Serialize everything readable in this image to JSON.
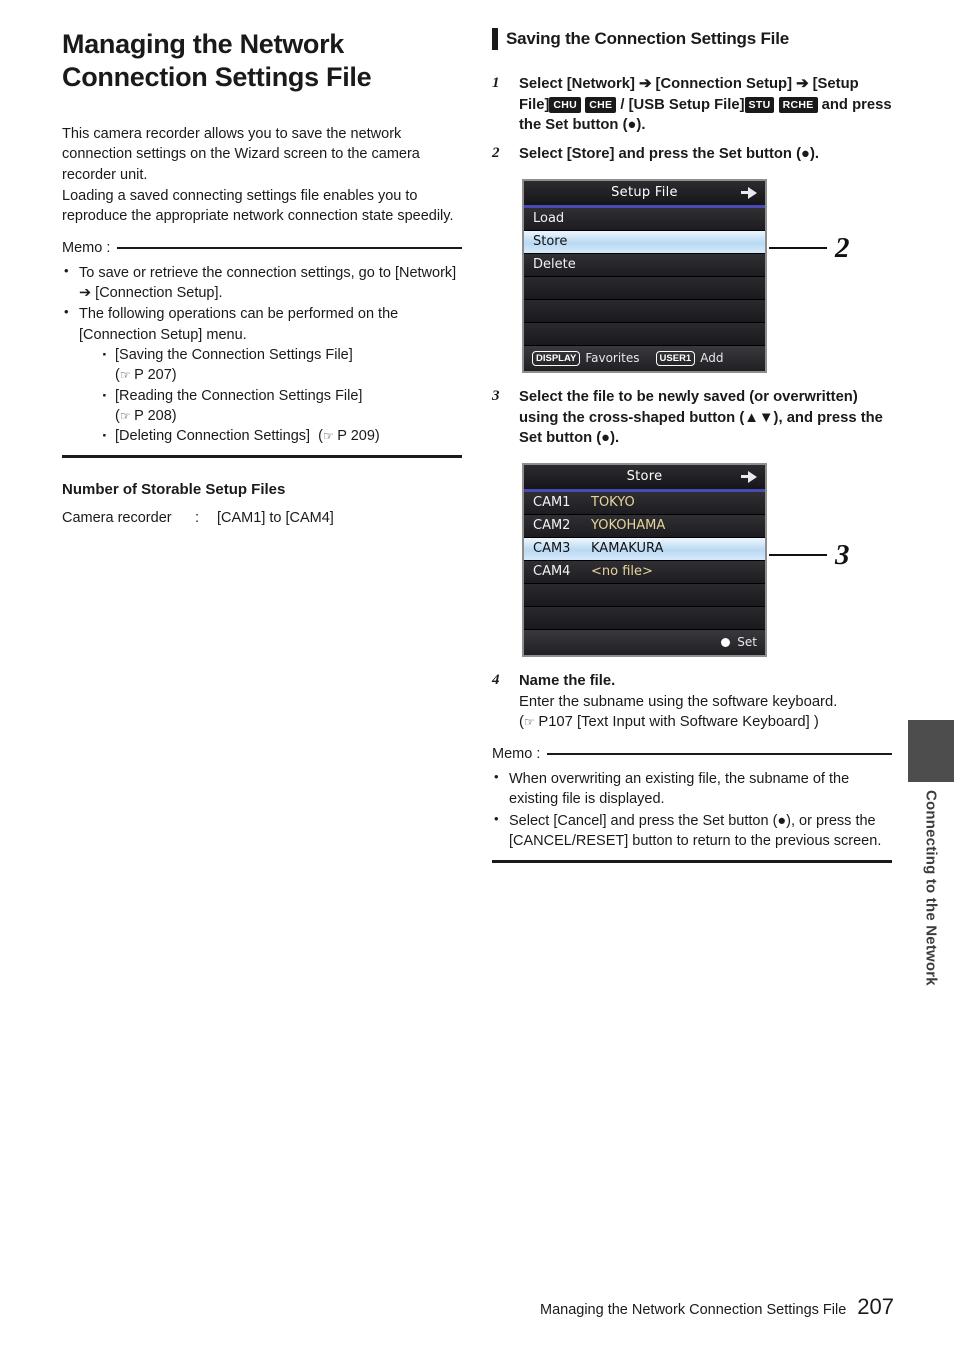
{
  "page": {
    "number": "207",
    "footer_title": "Managing the Network Connection Settings File",
    "side_tab": "Connecting to the Network"
  },
  "left": {
    "title": "Managing the Network Connection Settings File",
    "intro": "This camera recorder allows you to save the network connection settings on the Wizard screen to the camera recorder unit.\nLoading a saved connecting settings file enables you to reproduce the appropriate network connection state speedily.",
    "memo_label": "Memo :",
    "memo_items": [
      "To save or retrieve the connection settings, go to [Network] ➔ [Connection Setup].",
      "The following operations can be performed on the [Connection Setup] menu."
    ],
    "memo_sub_items": [
      {
        "text": "[Saving the Connection Settings File]",
        "ref": "P 207",
        "ref_same_line": false
      },
      {
        "text": "[Reading the Connection Settings File]",
        "ref": "P 208",
        "ref_same_line": false
      },
      {
        "text": "[Deleting Connection Settings]",
        "ref": "P 209",
        "ref_same_line": true
      }
    ],
    "storable_heading": "Number of Storable Setup Files",
    "storable_key": "Camera recorder",
    "storable_sep": ":",
    "storable_value": "[CAM1] to [CAM4]"
  },
  "right": {
    "section_title": "Saving the Connection Settings File",
    "step1": {
      "num": "1",
      "part_a": "Select [Network] ➔ [Connection Setup] ➔ [Setup File]",
      "badge_1": "CHU",
      "badge_2": "CHE",
      "part_b": "/ [USB Setup File]",
      "badge_3": "STU",
      "badge_4": "RCHE",
      "part_c": "and press the Set button (●)."
    },
    "step2": {
      "num": "2",
      "text": "Select [Store] and press the Set button (●)."
    },
    "step3": {
      "num": "3",
      "text": "Select the file to be newly saved (or overwritten) using the cross-shaped button (▲▼), and press the Set button (●)."
    },
    "step4": {
      "num": "4",
      "title": "Name the file.",
      "line1": "Enter the subname using the software keyboard.",
      "ref_open": "(",
      "ref_text": "P107 [Text Input with Software Keyboard] )"
    },
    "memo_label": "Memo :",
    "memo_items": [
      "When overwriting an existing file, the subname of the existing file is displayed.",
      "Select [Cancel] and press the Set button (●), or press the [CANCEL/RESET] button to return to the previous screen."
    ]
  },
  "screen_setup_file": {
    "title": "Setup File",
    "callout": "2",
    "rows": [
      {
        "label": "Load",
        "value": "",
        "selected": false
      },
      {
        "label": "Store",
        "value": "",
        "selected": true
      },
      {
        "label": "Delete",
        "value": "",
        "selected": false
      },
      {
        "label": "",
        "value": "",
        "selected": false
      },
      {
        "label": "",
        "value": "",
        "selected": false
      },
      {
        "label": "",
        "value": "",
        "selected": false
      }
    ],
    "footer": {
      "key1": "DISPLAY",
      "action1": "Favorites",
      "key2": "USER1",
      "action2": "Add"
    }
  },
  "screen_store": {
    "title": "Store",
    "callout": "3",
    "rows": [
      {
        "label": "CAM1",
        "value": "TOKYO",
        "selected": false
      },
      {
        "label": "CAM2",
        "value": "YOKOHAMA",
        "selected": false
      },
      {
        "label": "CAM3",
        "value": "KAMAKURA",
        "selected": true
      },
      {
        "label": "CAM4",
        "value": "<no file>",
        "selected": false
      },
      {
        "label": "",
        "value": "",
        "selected": false
      },
      {
        "label": "",
        "value": "",
        "selected": false
      }
    ],
    "footer": {
      "set_label": "Set"
    }
  },
  "colors": {
    "highlight_row": "#b9d9f2",
    "value_text": "#e6d49b",
    "header_underline": "#4a4ab4",
    "side_tab": "#4d4d4d"
  }
}
